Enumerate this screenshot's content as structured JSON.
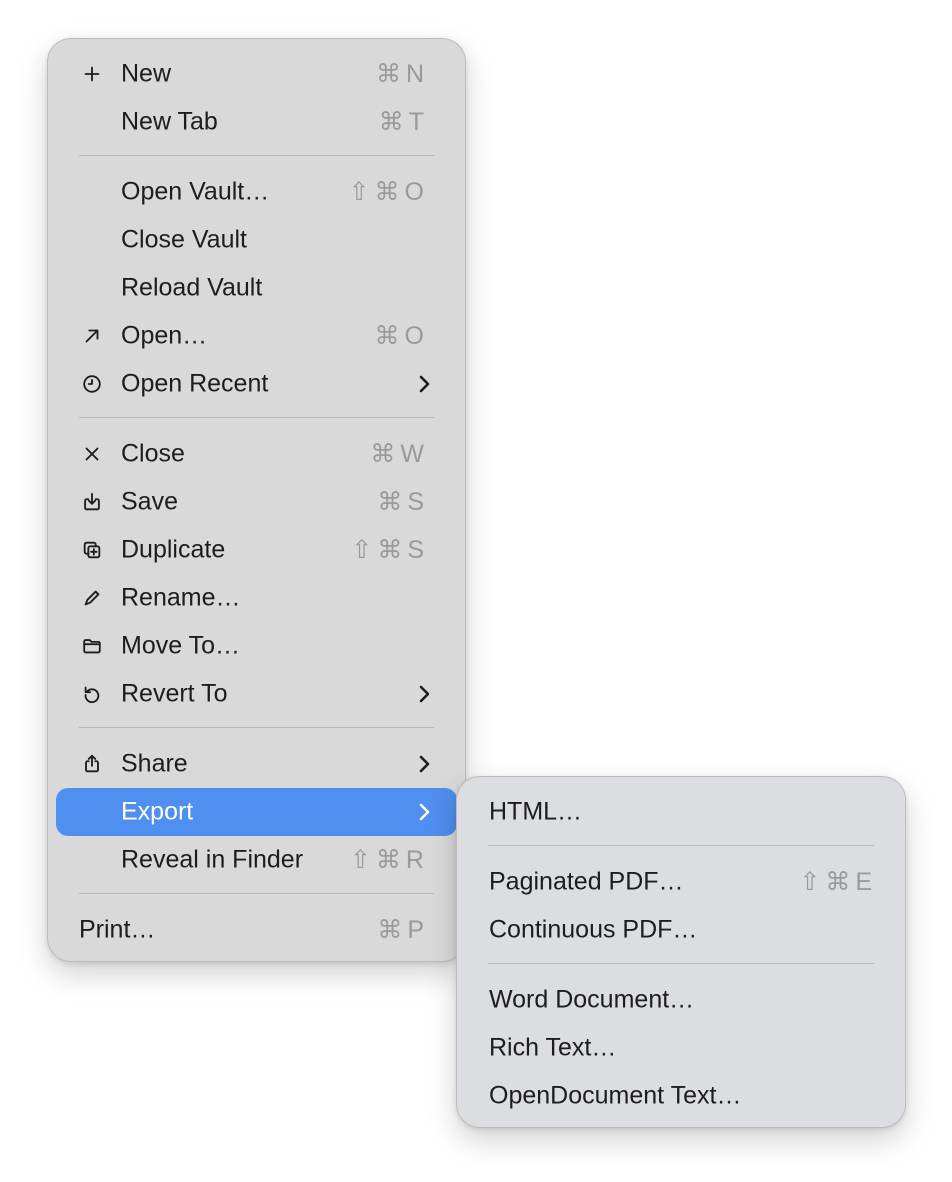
{
  "menu": {
    "new": {
      "label": "New",
      "shortcut": "⌘N",
      "icon": "plus-icon"
    },
    "new_tab": {
      "label": "New Tab",
      "shortcut": "⌘T"
    },
    "open_vault": {
      "label": "Open Vault…",
      "shortcut": "⇧⌘O"
    },
    "close_vault": {
      "label": "Close Vault"
    },
    "reload_vault": {
      "label": "Reload Vault"
    },
    "open": {
      "label": "Open…",
      "shortcut": "⌘O",
      "icon": "arrow-up-right-icon"
    },
    "open_recent": {
      "label": "Open Recent",
      "icon": "clock-icon"
    },
    "close": {
      "label": "Close",
      "shortcut": "⌘W",
      "icon": "x-icon"
    },
    "save": {
      "label": "Save",
      "shortcut": "⌘S",
      "icon": "save-icon"
    },
    "duplicate": {
      "label": "Duplicate",
      "shortcut": "⇧⌘S",
      "icon": "duplicate-icon"
    },
    "rename": {
      "label": "Rename…",
      "icon": "pencil-icon"
    },
    "move_to": {
      "label": "Move To…",
      "icon": "folder-icon"
    },
    "revert_to": {
      "label": "Revert To",
      "icon": "revert-icon"
    },
    "share": {
      "label": "Share",
      "icon": "share-icon"
    },
    "export": {
      "label": "Export"
    },
    "reveal_in_finder": {
      "label": "Reveal in Finder",
      "shortcut": "⇧⌘R"
    },
    "print": {
      "label": "Print…",
      "shortcut": "⌘P"
    }
  },
  "export_submenu": {
    "html": {
      "label": "HTML…"
    },
    "paginated_pdf": {
      "label": "Paginated PDF…",
      "shortcut": "⇧⌘E"
    },
    "continuous_pdf": {
      "label": "Continuous PDF…"
    },
    "word_document": {
      "label": "Word Document…"
    },
    "rich_text": {
      "label": "Rich Text…"
    },
    "opendocument_text": {
      "label": "OpenDocument Text…"
    }
  },
  "colors": {
    "selection": "#4f8ff0",
    "menu_background": "#d9d9d9",
    "shortcut_text": "#9a9a9a"
  }
}
